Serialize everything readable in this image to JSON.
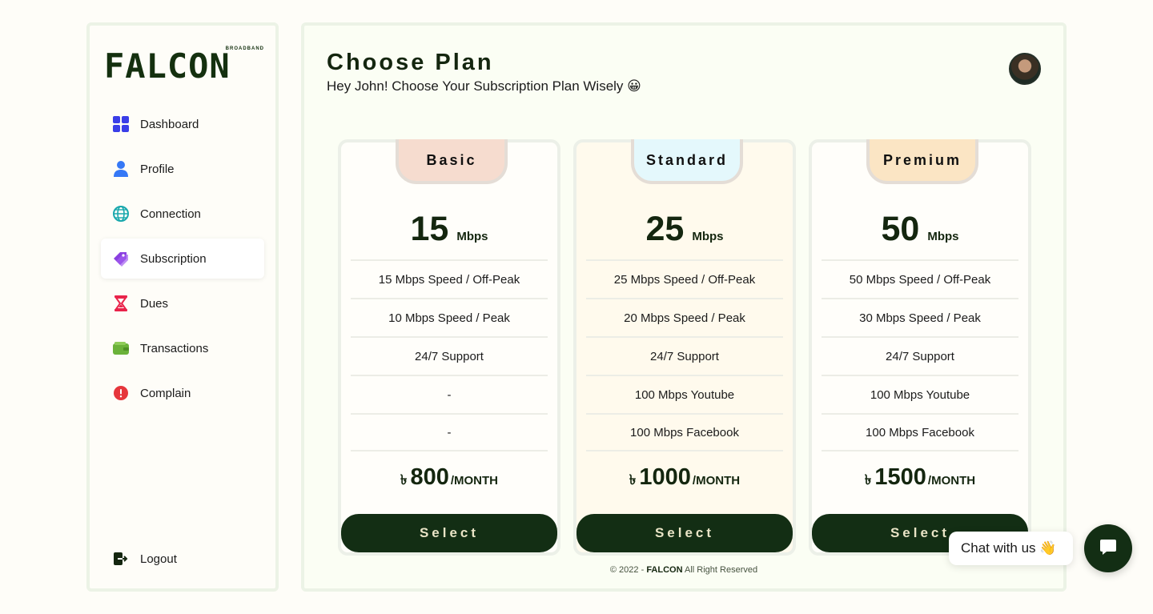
{
  "brand": {
    "name": "FALCON",
    "tagline": "BROADBAND"
  },
  "sidebar": {
    "items": [
      {
        "label": "Dashboard",
        "icon": "dashboard-grid-icon",
        "color": "#3a3ee8"
      },
      {
        "label": "Profile",
        "icon": "user-icon",
        "color": "#3578f6"
      },
      {
        "label": "Connection",
        "icon": "globe-icon",
        "color": "#19a8ad"
      },
      {
        "label": "Subscription",
        "icon": "tag-icon",
        "color": "#8a3fe0",
        "active": true
      },
      {
        "label": "Dues",
        "icon": "hourglass-icon",
        "color": "#e9234a"
      },
      {
        "label": "Transactions",
        "icon": "wallet-icon",
        "color": "#6bb23a"
      },
      {
        "label": "Complain",
        "icon": "alert-circle-icon",
        "color": "#e6363c"
      }
    ],
    "logout_label": "Logout"
  },
  "header": {
    "title": "Choose Plan",
    "subtitle": "Hey John! Choose Your Subscription Plan Wisely",
    "emoji": "😀"
  },
  "plans": [
    {
      "name": "Basic",
      "speed": "15",
      "unit": "Mbps",
      "features": [
        "15 Mbps Speed / Off-Peak",
        "10 Mbps Speed / Peak",
        "24/7 Support",
        "-",
        "-"
      ],
      "currency": "৳",
      "price": "800",
      "period": "/MONTH",
      "button": "Select",
      "badge_color": "#f6dccf"
    },
    {
      "name": "Standard",
      "speed": "25",
      "unit": "Mbps",
      "features": [
        "25 Mbps Speed / Off-Peak",
        "20 Mbps Speed / Peak",
        "24/7 Support",
        "100 Mbps Youtube",
        "100 Mbps Facebook"
      ],
      "currency": "৳",
      "price": "1000",
      "period": "/MONTH",
      "button": "Select",
      "badge_color": "#e4f8fc"
    },
    {
      "name": "Premium",
      "speed": "50",
      "unit": "Mbps",
      "features": [
        "50 Mbps Speed / Off-Peak",
        "30 Mbps Speed / Peak",
        "24/7 Support",
        "100 Mbps Youtube",
        "100 Mbps Facebook"
      ],
      "currency": "৳",
      "price": "1500",
      "period": "/MONTH",
      "button": "Select",
      "badge_color": "#fbe5c4"
    }
  ],
  "footer": {
    "prefix": "© 2022 - ",
    "brand": "FALCON",
    "suffix": " All Right Reserved"
  },
  "chat": {
    "label": "Chat with us",
    "emoji": "👋"
  },
  "colors": {
    "accent_dark": "#132e14",
    "button_text": "#e9e4c6"
  }
}
